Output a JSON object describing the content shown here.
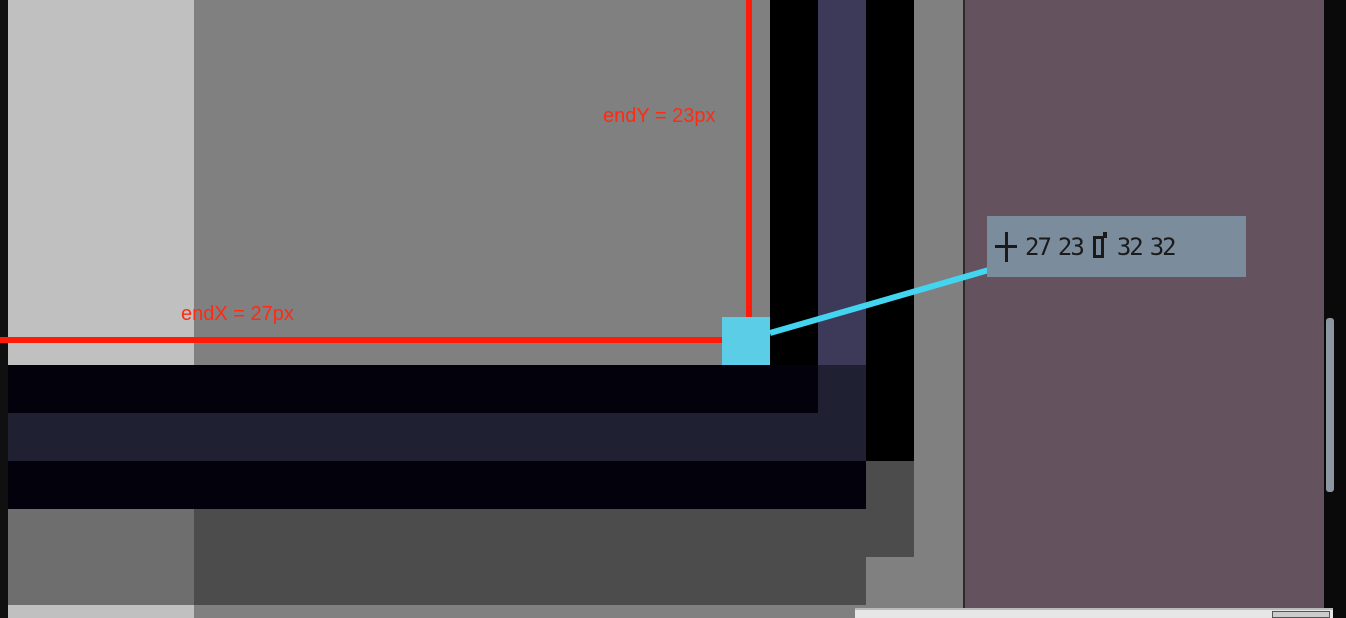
{
  "annotations": {
    "end_x_label": "endX = 27px",
    "end_y_label": "endY = 23px"
  },
  "readout": {
    "cursor_icon": "crosshair-icon",
    "cursor_x": "27",
    "cursor_y": "23",
    "size_icon": "selection-size-icon",
    "size_w": "32",
    "size_h": "32"
  },
  "colors": {
    "annotation_red": "#ff1a0a",
    "connector_cyan": "#43d4f0",
    "end_point_fill": "#5bcde6",
    "readout_bg": "#7b8d9c",
    "side_panel": "#64535f"
  }
}
